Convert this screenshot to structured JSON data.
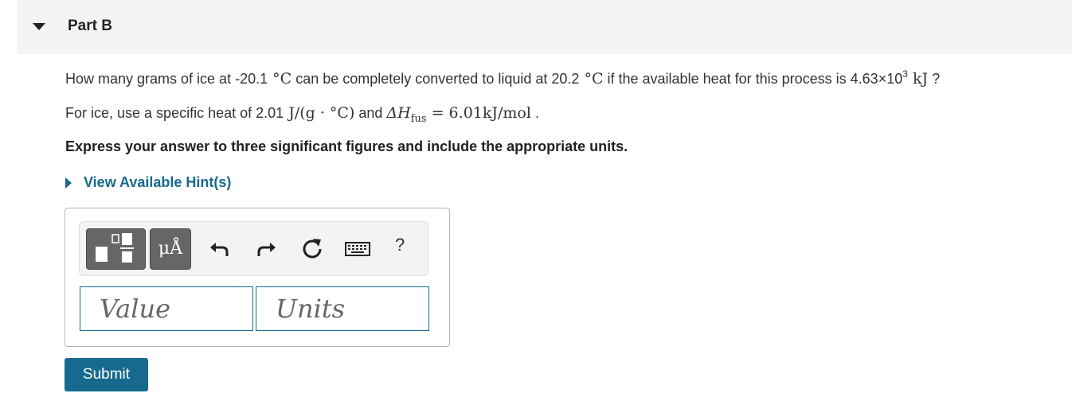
{
  "header": {
    "title": "Part B"
  },
  "question": {
    "l1_a": "How many grams of ice at -20.1",
    "l1_unit1": " °C",
    "l1_b": " can be completely converted to liquid at 20.2",
    "l1_unit2": " °C",
    "l1_c": " if the available heat for this process is 4.63×10",
    "l1_exp": "3",
    "l1_unit3": " kJ",
    "l1_d": " ?",
    "l2_a": "For ice, use a specific heat of 2.01",
    "l2_unit": " J/(g · °C)",
    "l2_b": " and ",
    "l2_dh": "ΔH",
    "l2_sub": "fus",
    "l2_eq": " = 6.01kJ/mol",
    "l2_c": " ."
  },
  "instruction": "Express your answer to three significant figures and include the appropriate units.",
  "hint_link": "View Available Hint(s)",
  "toolbar": {
    "units_label": "μÅ",
    "help_label": "?",
    "icons": [
      "templates-icon",
      "units-icon",
      "undo-icon",
      "redo-icon",
      "reset-icon",
      "keyboard-icon",
      "help-icon"
    ]
  },
  "inputs": {
    "value_placeholder": "Value",
    "units_placeholder": "Units"
  },
  "submit_label": "Submit",
  "colors": {
    "accent": "#176a8e",
    "header_bg": "#f4f4f4",
    "toolbar_btn": "#666666"
  }
}
